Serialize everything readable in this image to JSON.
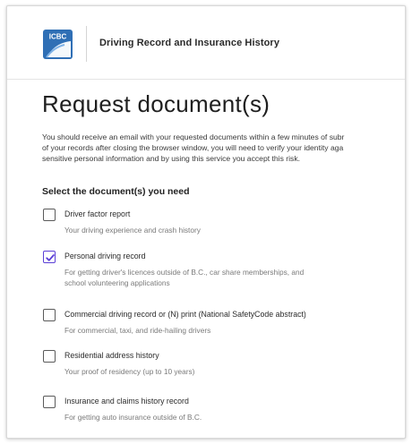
{
  "header": {
    "logo_text": "ICBC",
    "title": "Driving Record and Insurance History"
  },
  "main": {
    "page_title": "Request document(s)",
    "intro_lines": [
      "You should receive an email with your requested documents within a few minutes of subr",
      "of your records after closing the browser window, you will need to verify your identity aga",
      "sensitive personal information and by using this service you accept this risk."
    ],
    "section_label": "Select the document(s) you need",
    "options": [
      {
        "label": "Driver factor report",
        "desc": [
          "Your driving experience and crash history"
        ],
        "checked": false
      },
      {
        "label": "Personal driving record",
        "desc": [
          "For getting driver's licences outside of B.C., car share memberships, and",
          "school volunteering applications"
        ],
        "checked": true
      },
      {
        "label": "Commercial driving record or (N) print (National SafetyCode abstract)",
        "desc": [
          "For commercial, taxi, and ride-hailing drivers"
        ],
        "checked": false
      },
      {
        "label": "Residential address history",
        "desc": [
          "Your proof of residency (up to 10 years)"
        ],
        "checked": false
      },
      {
        "label": "Insurance and claims history record",
        "desc": [
          "For getting auto insurance outside of B.C."
        ],
        "checked": false
      }
    ]
  },
  "colors": {
    "brand_blue": "#2f6fb5",
    "check_accent": "#5b3fd6"
  },
  "icons": {
    "logo": "icbc-logo-icon",
    "check": "checkmark-icon"
  }
}
